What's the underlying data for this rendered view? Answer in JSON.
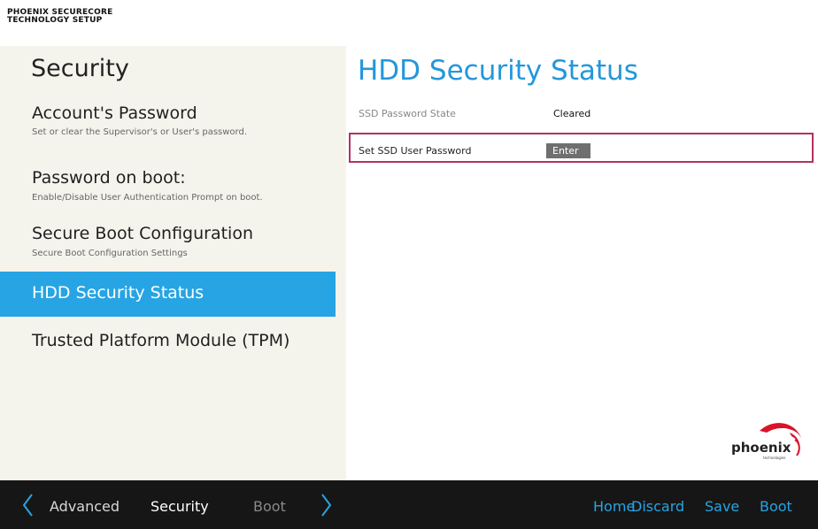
{
  "brand": {
    "line1": "PHOENIX SECURECORE",
    "line2": "TECHNOLOGY SETUP"
  },
  "sidebar": {
    "title": "Security",
    "items": [
      {
        "label": "Account's Password",
        "description": "Set or clear the Supervisor's or User's password."
      },
      {
        "label": "Password on boot:",
        "description": "Enable/Disable User Authentication Prompt on boot."
      },
      {
        "label": "Secure Boot Configuration",
        "description": "Secure Boot Configuration Settings"
      },
      {
        "label": "HDD Security Status",
        "description": "",
        "active": true
      },
      {
        "label": "Trusted Platform Module (TPM)",
        "description": ""
      }
    ]
  },
  "main": {
    "title": "HDD Security Status",
    "rows": [
      {
        "label": "SSD Password State",
        "value": "Cleared"
      },
      {
        "label": "Set SSD User Password",
        "value": "Enter",
        "selected": true
      }
    ]
  },
  "logo": {
    "text": "phoenix",
    "subtext": "technologies"
  },
  "bottombar": {
    "left_tabs": [
      "Advanced",
      "Security",
      "Boot"
    ],
    "active_tab": "Security",
    "right_actions": [
      "Home",
      "Discard",
      "Save",
      "Boot"
    ]
  },
  "colors": {
    "accent": "#27a4e3",
    "title_blue": "#2397db",
    "selection_border": "#b3325e",
    "sidebar_bg": "#f5f4ec",
    "bottombar_bg": "#161616",
    "logo_red": "#d8142b"
  },
  "icons": {
    "prev": "chevron-left-icon",
    "next": "chevron-right-icon",
    "logo": "phoenix-logo-swoosh-icon"
  }
}
